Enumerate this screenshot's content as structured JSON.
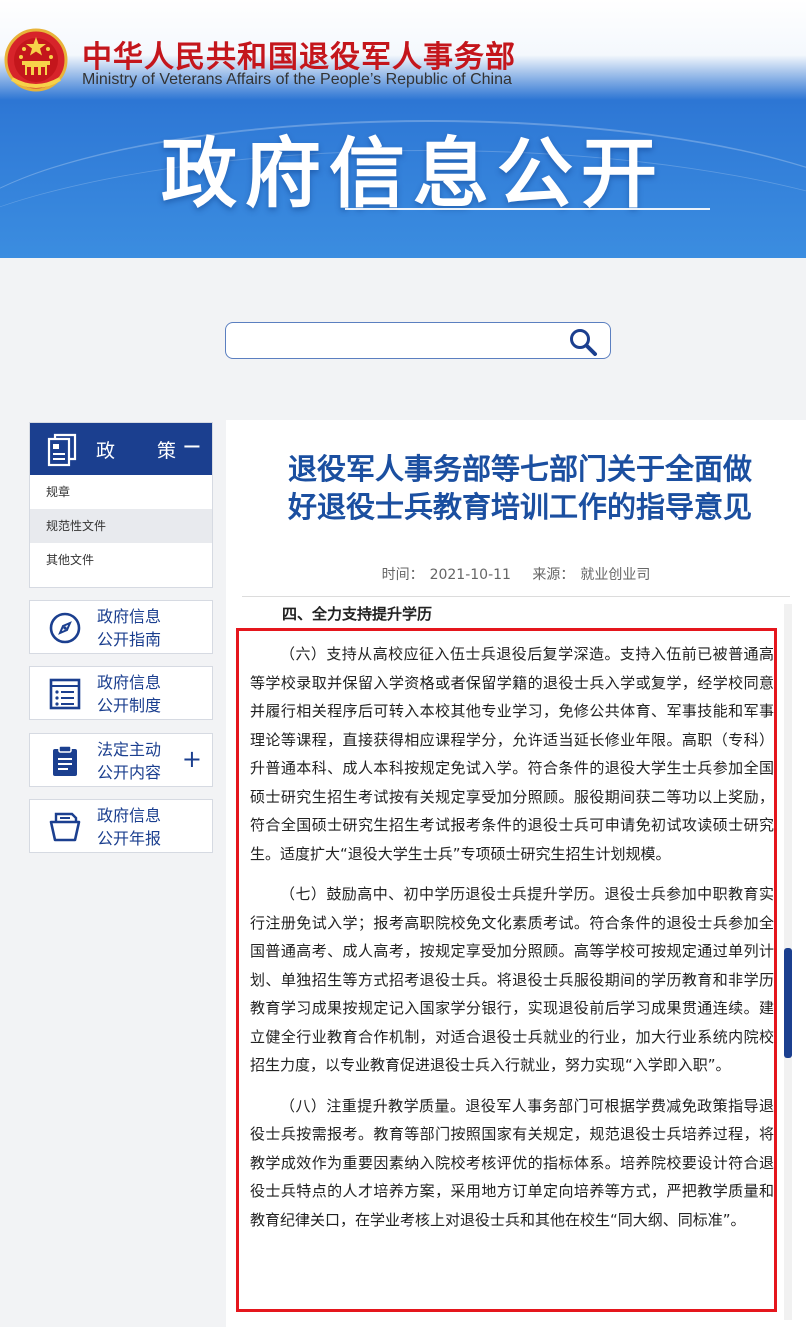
{
  "header": {
    "org_name_cn": "中华人民共和国退役军人事务部",
    "org_name_en": "Ministry of Veterans Affairs of the People’s Republic of China",
    "banner_title": "政府信息公开"
  },
  "search": {
    "value": "",
    "placeholder": ""
  },
  "sidebar": {
    "policy": {
      "title": "政策",
      "toggle": "−",
      "items": [
        {
          "label": "规章",
          "active": false
        },
        {
          "label": "规范性文件",
          "active": true
        },
        {
          "label": "其他文件",
          "active": false
        }
      ]
    },
    "links": [
      {
        "line1": "政府信息",
        "line2": "公开指南",
        "icon": "compass-icon"
      },
      {
        "line1": "政府信息",
        "line2": "公开制度",
        "icon": "list-document-icon"
      },
      {
        "line1": "法定主动",
        "line2": "公开内容",
        "icon": "clipboard-icon",
        "expand": "+"
      },
      {
        "line1": "政府信息",
        "line2": "公开年报",
        "icon": "open-folder-icon"
      }
    ]
  },
  "article": {
    "title_line1": "退役军人事务部等七部门关于全面做",
    "title_line2": "好退役士兵教育培训工作的指导意见",
    "meta": {
      "time_label": "时间：",
      "time": "2021-10-11",
      "source_label": "来源：",
      "source": "就业创业司"
    },
    "section_heading": "四、全力支持提升学历",
    "paragraphs": [
      "（六）支持从高校应征入伍士兵退役后复学深造。支持入伍前已被普通高等学校录取并保留入学资格或者保留学籍的退役士兵入学或复学，经学校同意并履行相关程序后可转入本校其他专业学习，免修公共体育、军事技能和军事理论等课程，直接获得相应课程学分，允许适当延长修业年限。高职（专科）升普通本科、成人本科按规定免试入学。符合条件的退役大学生士兵参加全国硕士研究生招生考试按有关规定享受加分照顾。服役期间获二等功以上奖励，符合全国硕士研究生招生考试报考条件的退役士兵可申请免初试攻读硕士研究生。适度扩大“退役大学生士兵”专项硕士研究生招生计划规模。",
      "（七）鼓励高中、初中学历退役士兵提升学历。退役士兵参加中职教育实行注册免试入学；报考高职院校免文化素质考试。符合条件的退役士兵参加全国普通高考、成人高考，按规定享受加分照顾。高等学校可按规定通过单列计划、单独招生等方式招考退役士兵。将退役士兵服役期间的学历教育和非学历教育学习成果按规定记入国家学分银行，实现退役前后学习成果贯通连续。建立健全行业教育合作机制，对适合退役士兵就业的行业，加大行业系统内院校招生力度，以专业教育促进退役士兵入行就业，努力实现“入学即入职”。",
      "（八）注重提升教学质量。退役军人事务部门可根据学费减免政策指导退役士兵按需报考。教育等部门按照国家有关规定，规范退役士兵培养过程，将教学成效作为重要因素纳入院校考核评优的指标体系。培养院校要设计符合退役士兵特点的人才培养方案，采用地方订单定向培养等方式，严把教学质量和教育纪律关口，在学业考核上对退役士兵和其他在校生“同大纲、同标准”。"
    ]
  },
  "colors": {
    "navy": "#1b3f8f",
    "title_blue": "#1b4fa0",
    "emblem_red": "#c4161c",
    "highlight_red": "#e5161d"
  }
}
